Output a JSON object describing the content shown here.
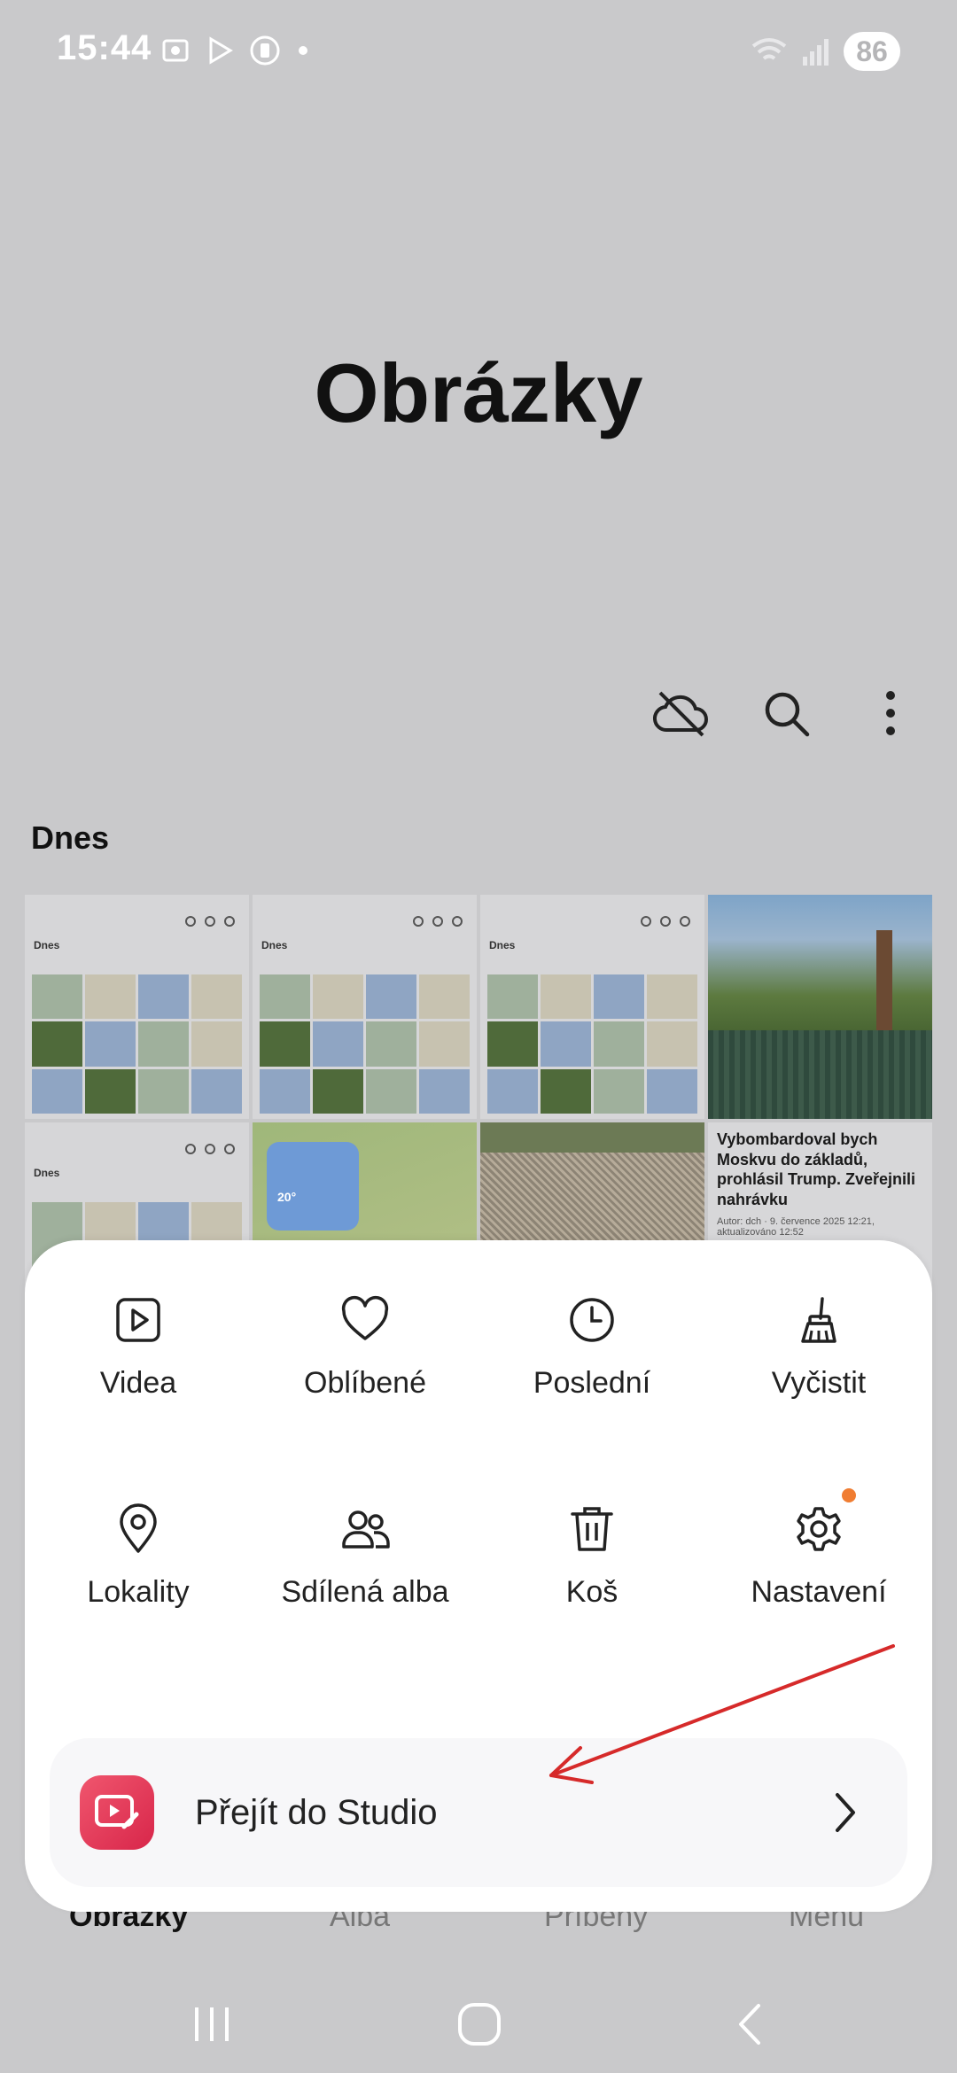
{
  "status_bar": {
    "time": "15:44",
    "battery": "86"
  },
  "app": {
    "title": "Obrázky"
  },
  "toolbar": {
    "icons": [
      "cloud-off-icon",
      "search-icon",
      "more-vert-icon"
    ]
  },
  "section": {
    "title": "Dnes"
  },
  "thumbnails": {
    "shot_title": "Dnes",
    "weather_temp": "20°",
    "article_headline": "Vybombardoval bych Moskvu do základů, prohlásil Trump. Zveřejnili nahrávku",
    "article_meta": "Autor: dch · 9. července 2025 12:21, aktualizováno 12:52"
  },
  "menu": {
    "items": [
      {
        "label": "Videa",
        "icon": "video-icon"
      },
      {
        "label": "Oblíbené",
        "icon": "heart-icon"
      },
      {
        "label": "Poslední",
        "icon": "clock-icon"
      },
      {
        "label": "Vyčistit",
        "icon": "broom-icon"
      },
      {
        "label": "Lokality",
        "icon": "location-pin-icon"
      },
      {
        "label": "Sdílená alba",
        "icon": "people-icon"
      },
      {
        "label": "Koš",
        "icon": "trash-icon"
      },
      {
        "label": "Nastavení",
        "icon": "gear-icon"
      }
    ],
    "studio_label": "Přejít do Studio"
  },
  "bottom_tabs": [
    "Obrázky",
    "Alba",
    "Příběhy",
    "Menu"
  ],
  "colors": {
    "accent_red": "#e0364f",
    "badge_orange": "#f07d32",
    "annotation_red": "#d62a2a"
  }
}
